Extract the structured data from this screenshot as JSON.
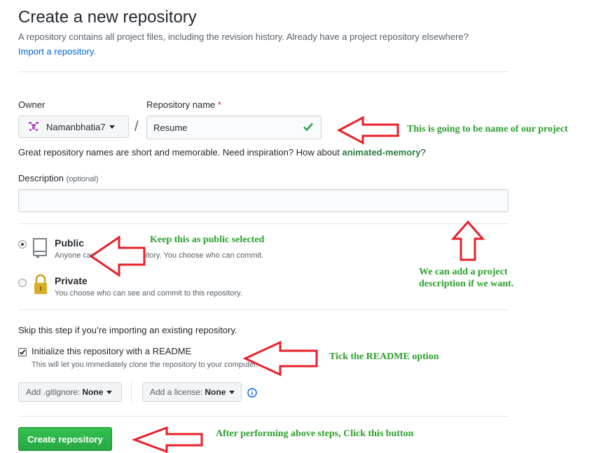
{
  "page": {
    "title": "Create a new repository",
    "subtitle": "A repository contains all project files, including the revision history. Already have a project repository elsewhere?",
    "import_link": "Import a repository."
  },
  "owner": {
    "label": "Owner",
    "value": "Namanbhatia7",
    "slash": "/"
  },
  "repo_name": {
    "label": "Repository name",
    "required_mark": "*",
    "value": "Resume",
    "hint_prefix": "Great repository names are short and memorable. Need inspiration? How about",
    "suggestion": "animated-memory",
    "hint_suffix": "?"
  },
  "description": {
    "label": "Description",
    "optional": "(optional)",
    "value": ""
  },
  "visibility": {
    "public_label": "Public",
    "public_note": "Anyone can see this repository. You choose who can commit.",
    "private_label": "Private",
    "private_note": "You choose who can see and commit to this repository.",
    "selected": "public"
  },
  "init": {
    "skip_note": "Skip this step if you’re importing an existing repository.",
    "readme_label": "Initialize this repository with a README",
    "readme_note": "This will let you immediately clone the repository to your computer.",
    "readme_checked": true
  },
  "gitignore": {
    "label": "Add .gitignore:",
    "value": "None"
  },
  "license": {
    "label": "Add a license:",
    "value": "None"
  },
  "create_button": "Create repository",
  "annotations": {
    "name": "This is going to be name of our project",
    "public": "Keep this as public selected",
    "description_line1": "We can add a project",
    "description_line2": "description if we want.",
    "readme": "Tick the README option",
    "button": "After performing above steps, Click this button"
  },
  "colors": {
    "annotation_text": "#2ca02c",
    "arrow": "#e8202a",
    "create_button": "#28a745",
    "link": "#0366d6"
  },
  "icons": {
    "owner_avatar": "identicon-icon",
    "valid": "check-icon",
    "public": "book-icon",
    "private": "lock-icon",
    "info": "info-icon"
  }
}
